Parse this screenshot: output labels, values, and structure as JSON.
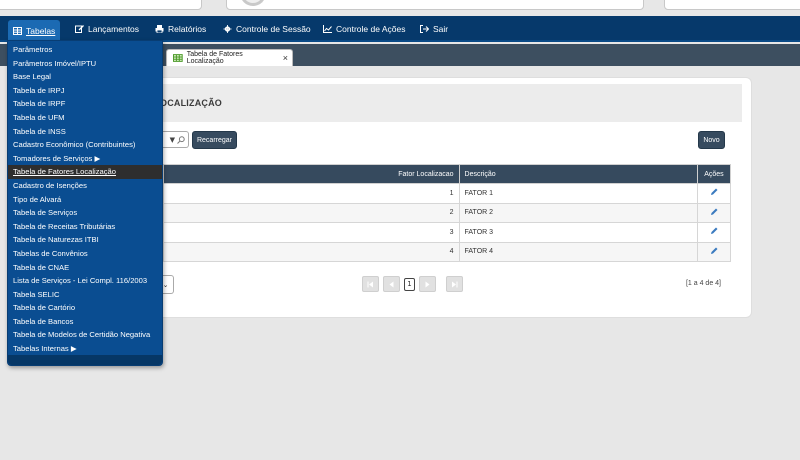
{
  "navbar": {
    "items": [
      {
        "label": "Tabelas",
        "icon": "table-icon"
      },
      {
        "label": "Lançamentos",
        "icon": "edit-icon"
      },
      {
        "label": "Relatórios",
        "icon": "printer-icon"
      },
      {
        "label": "Controle de Sessão",
        "icon": "gear-icon"
      },
      {
        "label": "Controle de Ações",
        "icon": "chart-icon"
      },
      {
        "label": "Sair",
        "icon": "logout-icon"
      }
    ]
  },
  "tab": {
    "label": "Tabela de Fatores Localização",
    "close": "×"
  },
  "panel": {
    "title": "OCALIZAÇÃO"
  },
  "toolbar": {
    "reload_label": "Recarregar",
    "new_label": "Novo"
  },
  "table": {
    "headers": {
      "fator": "Fator Localizacao",
      "descricao": "Descrição",
      "acoes": "Ações"
    },
    "rows": [
      {
        "fator": "1",
        "descricao": "FATOR 1"
      },
      {
        "fator": "2",
        "descricao": "FATOR 2"
      },
      {
        "fator": "3",
        "descricao": "FATOR 3"
      },
      {
        "fator": "4",
        "descricao": "FATOR 4"
      }
    ]
  },
  "pager": {
    "current_page": "1",
    "records": "[1 a 4 de 4]"
  },
  "menu": {
    "items": [
      "Parâmetros",
      "Parâmetros Imóvel/IPTU",
      "Base Legal",
      "Tabela de IRPJ",
      "Tabela de IRPF",
      "Tabela de UFM",
      "Tabela de INSS",
      "Cadastro Econômico (Contribuintes)",
      "Tomadores de Serviços ▶",
      "Tabela de Fatores Localização",
      "Cadastro de Isenções",
      "Tipo de Alvará",
      "Tabela de Serviços",
      "Tabela de Receitas Tributárias",
      "Tabela de Naturezas ITBI",
      "Tabelas de Convênios",
      "Tabela de CNAE",
      "Lista de Serviços - Lei Compl. 116/2003",
      "Tabela SELIC",
      "Tabela de Cartório",
      "Tabela de Bancos",
      "Tabela de Modelos de Certidão Negativa",
      "Tabelas Internas ▶"
    ],
    "selected_index": 9
  },
  "colors": {
    "navbar": "#06396b",
    "menu": "#0a4d91",
    "header_row": "#364a5e",
    "selected": "#2e2e2e"
  }
}
